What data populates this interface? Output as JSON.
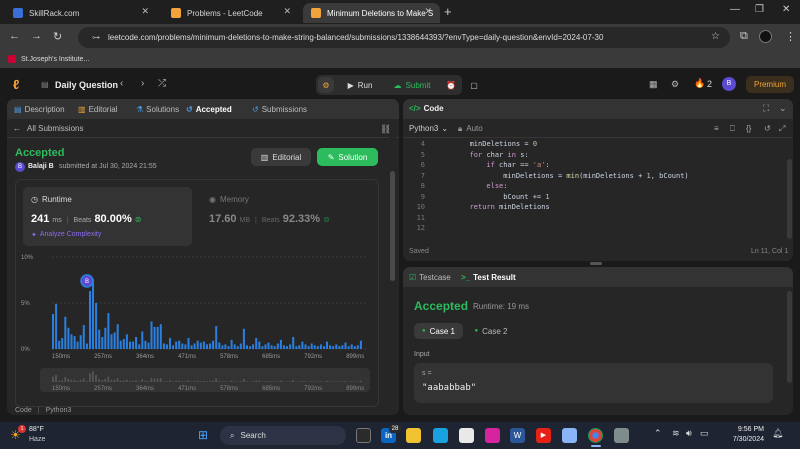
{
  "browser": {
    "tabs": [
      {
        "title": "SkillRack.com",
        "color": "#3b6fd8"
      },
      {
        "title": "Problems - LeetCode",
        "color": "#f2a33a"
      },
      {
        "title": "Minimum Deletions to Make S",
        "color": "#f2a33a"
      }
    ],
    "url": "leetcode.com/problems/minimum-deletions-to-make-string-balanced/submissions/1338644393/?envType=daily-question&envId=2024-07-30",
    "bookmark": "St.Joseph's Institute..."
  },
  "header": {
    "title": "Daily Question",
    "run_label": "Run",
    "submit_label": "Submit",
    "streak": "2",
    "avatar": "B",
    "premium_label": "Premium"
  },
  "left_tabs": [
    "Description",
    "Editorial",
    "Solutions",
    "Accepted",
    "Submissions"
  ],
  "submission": {
    "back_label": "All Submissions",
    "status": "Accepted",
    "user_initial": "B",
    "user": "Balaji B",
    "submitted_text": "submitted at Jul 30, 2024 21:55",
    "editorial_btn": "Editorial",
    "solution_btn": "Solution",
    "runtime_label": "Runtime",
    "runtime_value": "241",
    "runtime_unit": "ms",
    "runtime_beats_label": "Beats",
    "runtime_beats": "80.00%",
    "analyze_label": "Analyze Complexity",
    "memory_label": "Memory",
    "memory_value": "17.60",
    "memory_unit": "MB",
    "memory_beats_label": "Beats",
    "memory_beats": "92.33%",
    "code_label": "Code",
    "lang_label": "Python3"
  },
  "chart_data": {
    "type": "bar",
    "y_ticks": [
      "10%",
      "5%",
      "0%"
    ],
    "x_ticks": [
      "150ms",
      "257ms",
      "364ms",
      "471ms",
      "578ms",
      "685ms",
      "792ms",
      "899ms"
    ],
    "ylim": [
      0,
      10
    ],
    "marker_label": "B",
    "marker_value_ms": 241,
    "accent": "#2a80e0",
    "values": [
      3.8,
      4.9,
      0.9,
      1.2,
      3.5,
      2.3,
      1.6,
      1.4,
      0.8,
      1.5,
      2.6,
      0.6,
      6.3,
      7.6,
      5.0,
      2.1,
      1.3,
      2.3,
      3.9,
      1.6,
      1.8,
      2.7,
      0.9,
      1.1,
      1.6,
      0.8,
      0.8,
      1.3,
      0.5,
      1.9,
      0.9,
      0.7,
      3.0,
      2.4,
      2.4,
      2.7,
      0.6,
      0.5,
      1.2,
      0.4,
      0.8,
      0.9,
      0.6,
      0.5,
      1.2,
      0.4,
      0.6,
      0.9,
      0.7,
      0.8,
      0.5,
      0.6,
      0.9,
      2.5,
      0.7,
      0.4,
      0.5,
      0.3,
      1.0,
      0.5,
      0.3,
      0.6,
      2.2,
      0.4,
      0.3,
      0.5,
      1.2,
      0.8,
      0.3,
      0.5,
      0.7,
      0.4,
      0.3,
      0.6,
      1.0,
      0.4,
      0.3,
      0.5,
      1.3,
      0.3,
      0.4,
      0.8,
      0.5,
      0.3,
      0.6,
      0.4,
      0.3,
      0.5,
      0.3,
      0.8,
      0.4,
      0.3,
      0.5,
      0.3,
      0.4,
      0.7,
      0.3,
      0.5,
      0.3,
      0.4,
      0.9
    ]
  },
  "editor": {
    "title": "Code",
    "language": "Python3",
    "auto_label": "Auto",
    "lines": [
      {
        "n": "4",
        "indent": 8,
        "text": "minDeletions = 0"
      },
      {
        "n": "5",
        "indent": 8,
        "text": "for char in s:"
      },
      {
        "n": "6",
        "indent": 12,
        "text": "if char == 'a':"
      },
      {
        "n": "7",
        "indent": 16,
        "text": "minDeletions = min(minDeletions + 1, bCount)"
      },
      {
        "n": "8",
        "indent": 12,
        "text": "else:"
      },
      {
        "n": "9",
        "indent": 16,
        "text": "bCount += 1"
      },
      {
        "n": "10",
        "indent": 8,
        "text": "return minDeletions"
      },
      {
        "n": "11",
        "indent": 0,
        "text": ""
      },
      {
        "n": "12",
        "indent": 0,
        "text": ""
      }
    ],
    "saved_label": "Saved",
    "cursor_pos": "Ln 11, Col 1"
  },
  "result": {
    "testcase_tab": "Testcase",
    "result_tab": "Test Result",
    "status": "Accepted",
    "runtime": "Runtime: 19 ms",
    "case1": "Case 1",
    "case2": "Case 2",
    "input_label": "Input",
    "var_name": "s =",
    "var_value": "\"aababbab\""
  },
  "taskbar": {
    "temp": "88°F",
    "weather": "Haze",
    "search": "Search",
    "badge": "28",
    "time": "9:56 PM",
    "date": "7/30/2024"
  }
}
